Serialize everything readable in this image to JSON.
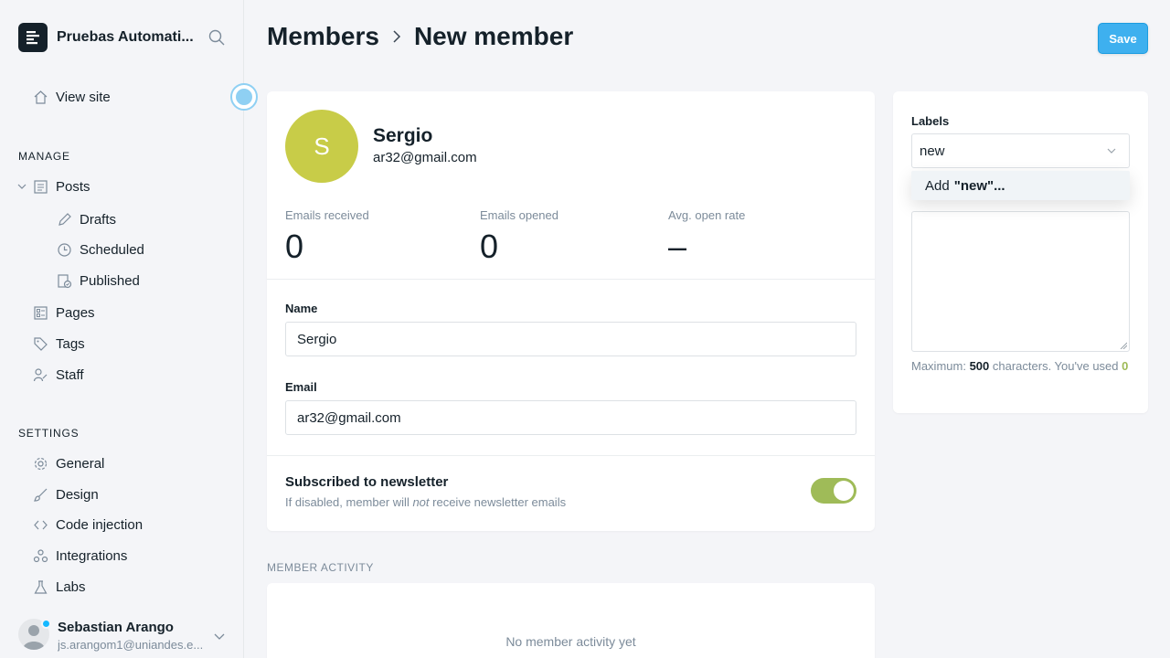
{
  "sidebar": {
    "brand": "Pruebas Automati...",
    "view_site": "View site",
    "manage_heading": "MANAGE",
    "manage_items": [
      {
        "label": "Posts"
      },
      {
        "label": "Drafts"
      },
      {
        "label": "Scheduled"
      },
      {
        "label": "Published"
      },
      {
        "label": "Pages"
      },
      {
        "label": "Tags"
      },
      {
        "label": "Staff"
      }
    ],
    "settings_heading": "SETTINGS",
    "settings_items": [
      {
        "label": "General"
      },
      {
        "label": "Design"
      },
      {
        "label": "Code injection"
      },
      {
        "label": "Integrations"
      },
      {
        "label": "Labs"
      }
    ],
    "user": {
      "name": "Sebastian Arango",
      "email": "js.arangom1@uniandes.e..."
    }
  },
  "header": {
    "crumb_parent": "Members",
    "crumb_current": "New member",
    "save_label": "Save"
  },
  "member": {
    "initial": "S",
    "name": "Sergio",
    "email": "ar32@gmail.com",
    "stats": [
      {
        "label": "Emails received",
        "value": "0"
      },
      {
        "label": "Emails opened",
        "value": "0"
      },
      {
        "label": "Avg. open rate",
        "value": "–"
      }
    ],
    "name_label": "Name",
    "name_value": "Sergio",
    "email_label": "Email",
    "email_value": "ar32@gmail.com",
    "newsletter_title": "Subscribed to newsletter",
    "newsletter_sub_pre": "If disabled, member will ",
    "newsletter_sub_em": "not",
    "newsletter_sub_post": " receive newsletter emails",
    "newsletter_enabled": true
  },
  "activity": {
    "heading": "MEMBER ACTIVITY",
    "empty": "No member activity yet"
  },
  "labels_panel": {
    "heading": "Labels",
    "input_value": "new",
    "dropdown_prefix": "Add",
    "dropdown_term": "\"new\"...",
    "hint_pre": "Maximum: ",
    "hint_max": "500",
    "hint_mid": " characters. You've used ",
    "hint_used": "0"
  },
  "colors": {
    "accent": "#3eb0ef",
    "avatar": "#c8cc48",
    "toggle_on": "#9fbb58"
  }
}
